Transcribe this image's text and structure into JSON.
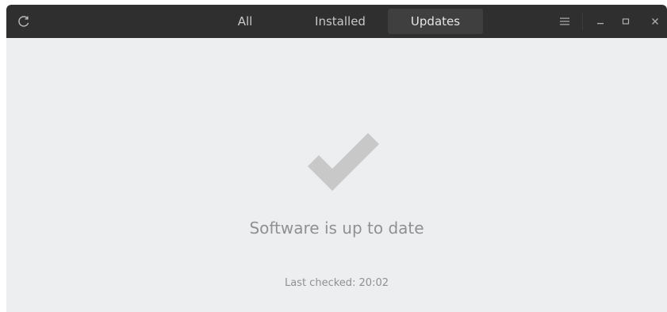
{
  "header": {
    "tabs": [
      {
        "label": "All"
      },
      {
        "label": "Installed"
      },
      {
        "label": "Updates",
        "active": true
      }
    ],
    "icons": {
      "refresh": "refresh-icon",
      "menu": "hamburger-menu-icon",
      "minimize": "minimize-icon",
      "maximize": "maximize-icon",
      "close": "close-icon"
    }
  },
  "main": {
    "status_icon": "checkmark-icon",
    "status_title": "Software is up to date",
    "last_checked": "Last checked: 20:02"
  },
  "colors": {
    "headerbar": "#2f2f2f",
    "active_tab": "#3f3f3f",
    "content_bg": "#edeef0",
    "checkmark": "#c8c8c8",
    "muted_text": "#8f9092"
  }
}
